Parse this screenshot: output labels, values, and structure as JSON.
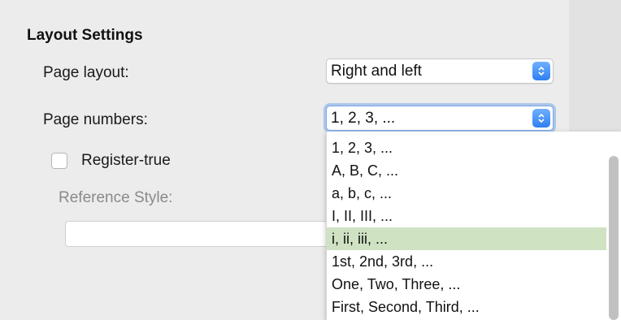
{
  "section": {
    "title": "Layout Settings"
  },
  "page_layout": {
    "label": "Page layout:",
    "value": "Right and left"
  },
  "page_numbers": {
    "label": "Page numbers:",
    "value": "1, 2, 3, ...",
    "options": [
      "1, 2, 3, ...",
      "A, B, C, ...",
      "a, b, c, ...",
      "I, II, III, ...",
      "i, ii, iii, ...",
      "1st, 2nd, 3rd, ...",
      "One, Two, Three, ...",
      "First, Second, Third, ..."
    ],
    "highlighted_option": "i, ii, iii, ..."
  },
  "register_true": {
    "label": "Register-true",
    "checked": false
  },
  "reference_style": {
    "label": "Reference Style:",
    "value": ""
  },
  "colors": {
    "accent": "#2f7ff1",
    "highlight": "#cfe3c3"
  }
}
